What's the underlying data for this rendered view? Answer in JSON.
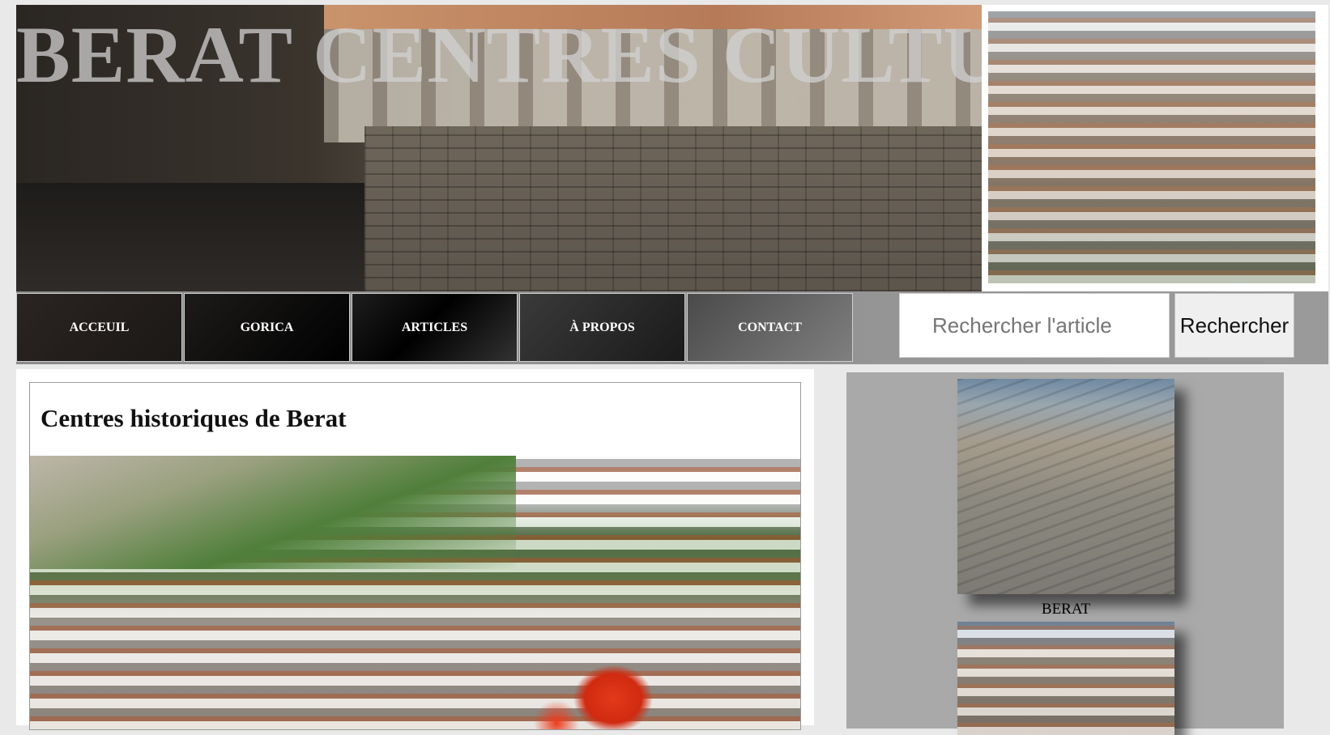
{
  "header": {
    "banner_title": "BERAT CENTRES CULTURELLES",
    "banner_image": "stone-bridge-photo",
    "top_right_image": "berat-hillside-houses-photo"
  },
  "nav": {
    "items": [
      {
        "label": "ACCEUIL"
      },
      {
        "label": "GORICA"
      },
      {
        "label": "ARTICLES"
      },
      {
        "label": "À PROPOS"
      },
      {
        "label": "CONTACT"
      }
    ],
    "search": {
      "placeholder": "Rechercher l'article",
      "button_label": "Rechercher"
    }
  },
  "article": {
    "title": "Centres historiques de Berat",
    "image": "berat-town-with-poppies-photo"
  },
  "sidebar": {
    "items": [
      {
        "image": "cobblestone-street-photo",
        "caption": "BERAT"
      },
      {
        "image": "berat-houses-photo"
      }
    ]
  },
  "colors": {
    "page_background": "#e9e9e9",
    "nav_text": "#ffffff",
    "sidebar_background": "#a9a9a9"
  }
}
